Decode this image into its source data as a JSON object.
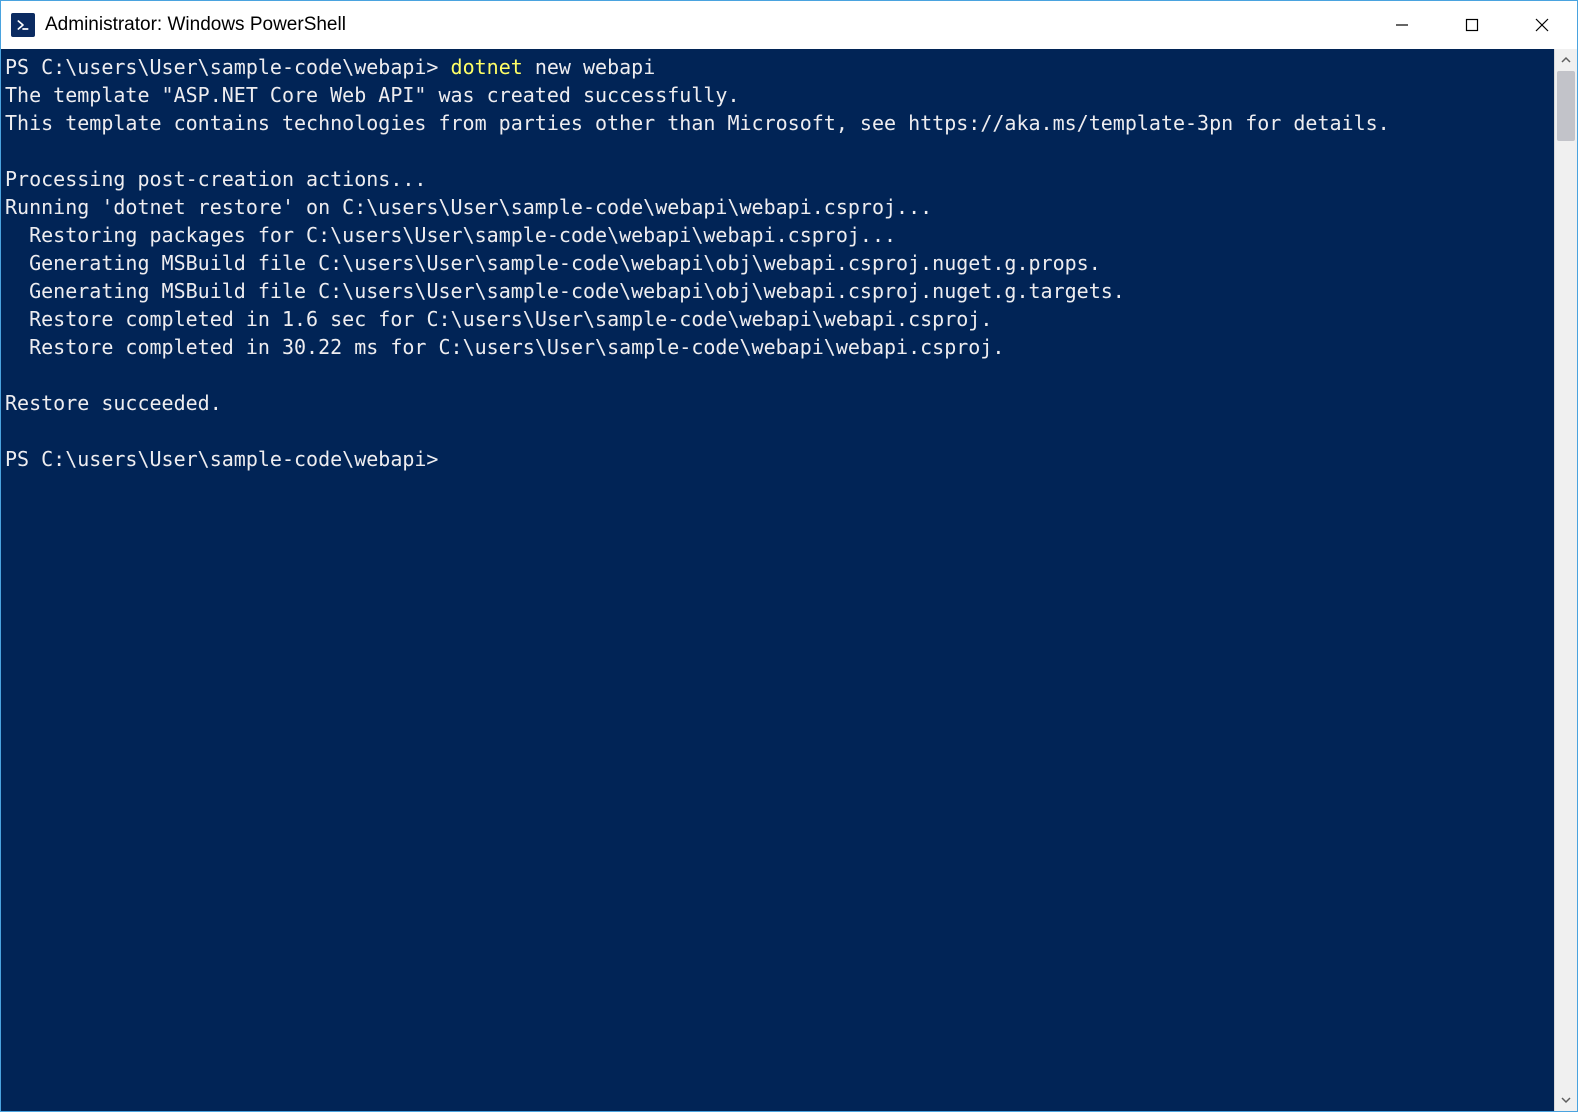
{
  "titlebar": {
    "title": "Administrator: Windows PowerShell"
  },
  "terminal": {
    "prompt1_prefix": "PS C:\\users\\User\\sample-code\\webapi> ",
    "cmd_highlight": "dotnet ",
    "cmd_rest": "new webapi",
    "lines": [
      "The template \"ASP.NET Core Web API\" was created successfully.",
      "This template contains technologies from parties other than Microsoft, see https://aka.ms/template-3pn for details.",
      "",
      "Processing post-creation actions...",
      "Running 'dotnet restore' on C:\\users\\User\\sample-code\\webapi\\webapi.csproj...",
      "  Restoring packages for C:\\users\\User\\sample-code\\webapi\\webapi.csproj...",
      "  Generating MSBuild file C:\\users\\User\\sample-code\\webapi\\obj\\webapi.csproj.nuget.g.props.",
      "  Generating MSBuild file C:\\users\\User\\sample-code\\webapi\\obj\\webapi.csproj.nuget.g.targets.",
      "  Restore completed in 1.6 sec for C:\\users\\User\\sample-code\\webapi\\webapi.csproj.",
      "  Restore completed in 30.22 ms for C:\\users\\User\\sample-code\\webapi\\webapi.csproj.",
      "",
      "Restore succeeded.",
      ""
    ],
    "prompt2": "PS C:\\users\\User\\sample-code\\webapi>"
  }
}
